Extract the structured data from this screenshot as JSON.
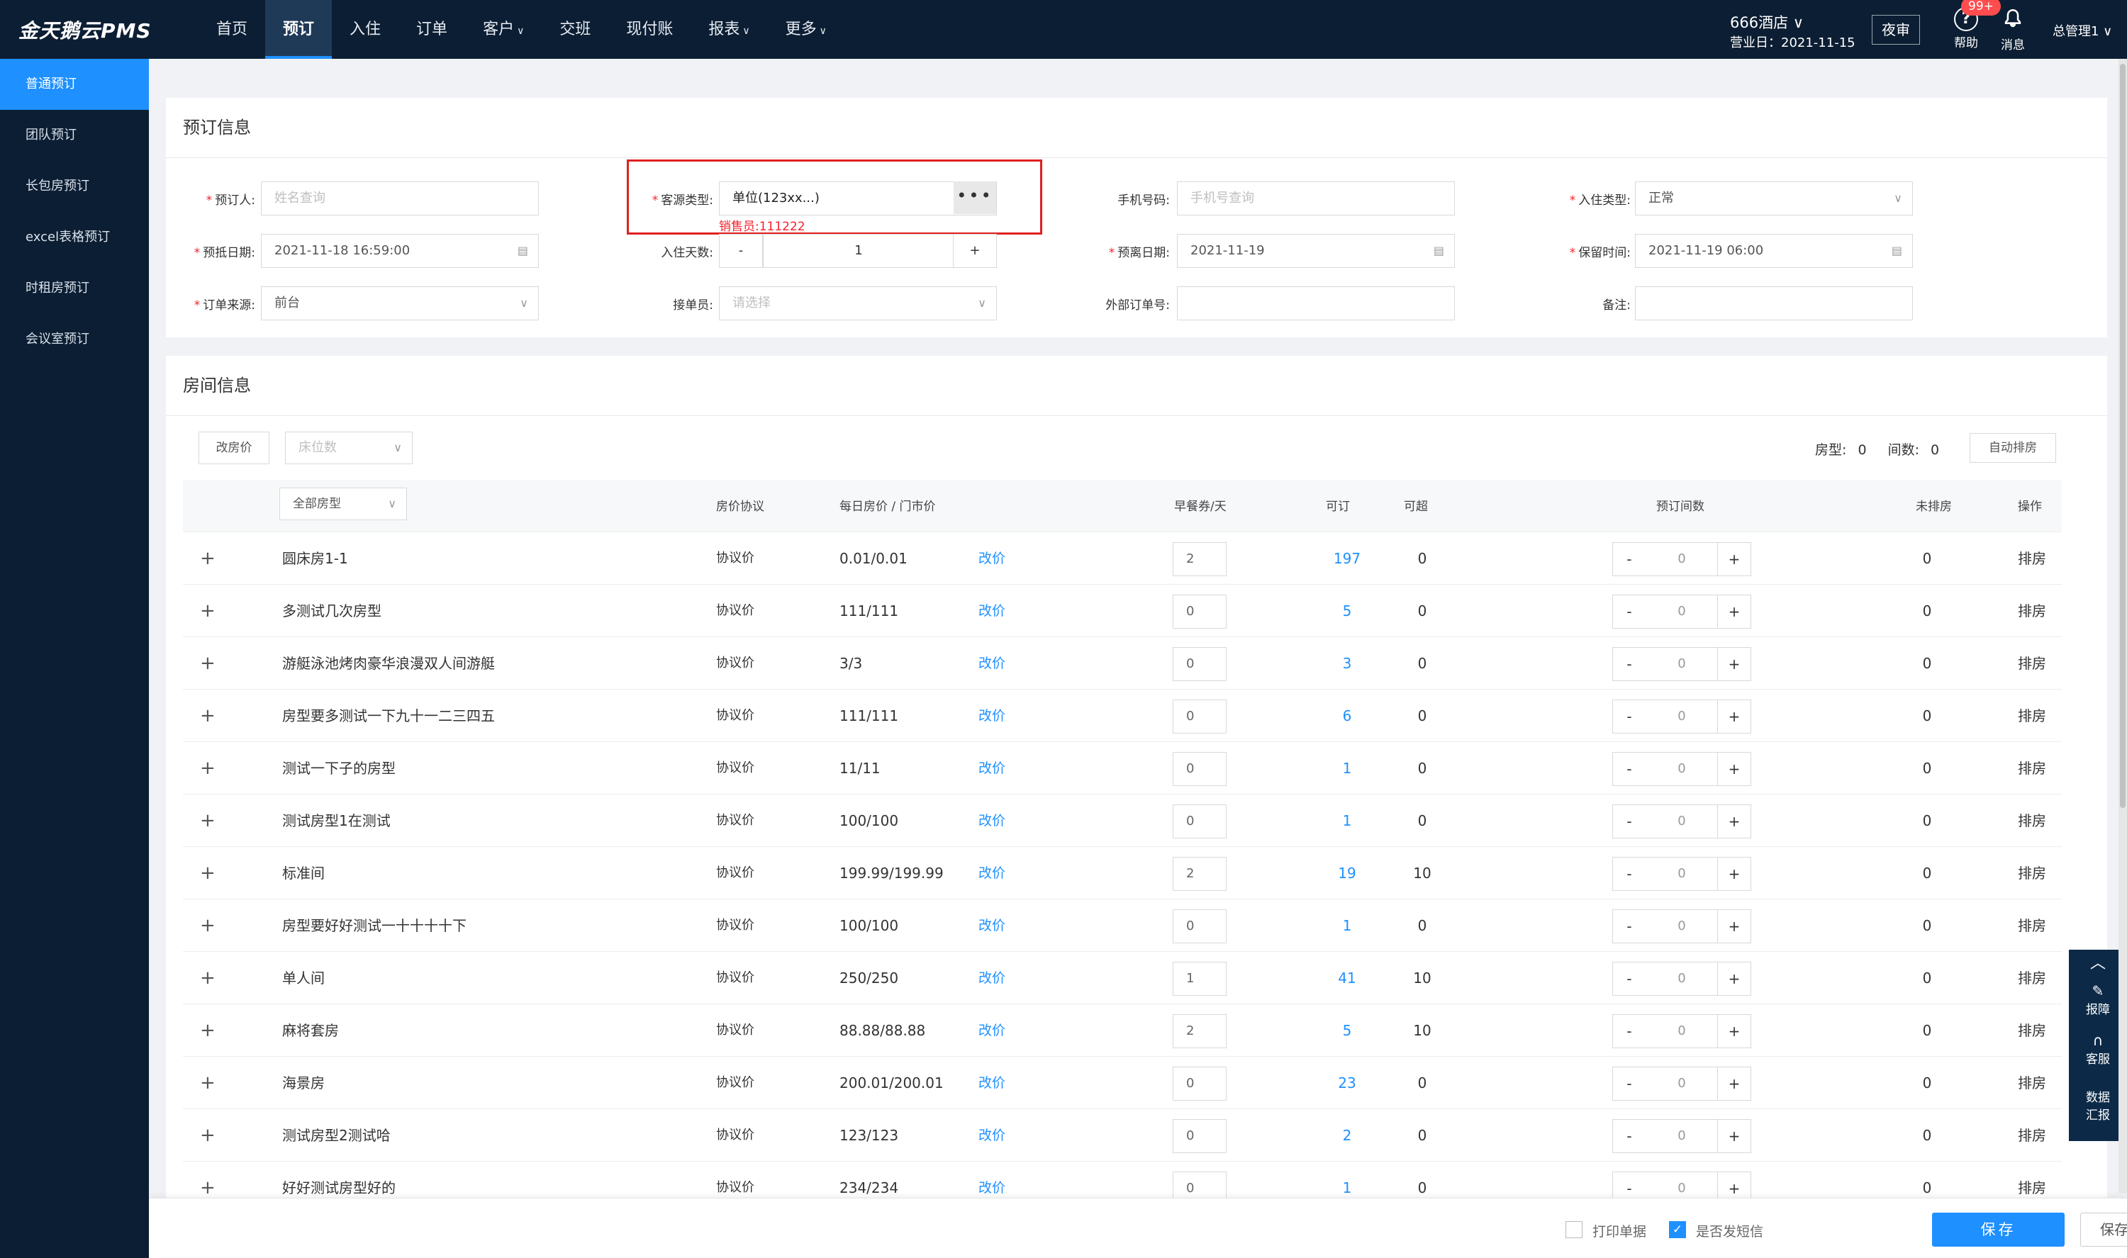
{
  "app": {
    "logo": "金天鹅云PMS"
  },
  "nav": [
    {
      "label": "首页",
      "caret": ""
    },
    {
      "label": "预订",
      "caret": "",
      "active": true
    },
    {
      "label": "入住",
      "caret": ""
    },
    {
      "label": "订单",
      "caret": ""
    },
    {
      "label": "客户",
      "caret": "∨"
    },
    {
      "label": "交班",
      "caret": ""
    },
    {
      "label": "现付账",
      "caret": ""
    },
    {
      "label": "报表",
      "caret": "∨"
    },
    {
      "label": "更多",
      "caret": "∨"
    }
  ],
  "header": {
    "hotel": "666酒店 ∨",
    "business_date": "营业日：2021-11-15",
    "audit": "夜审",
    "help": "帮助",
    "messages": "消息",
    "badge": "99+",
    "admin": "总管理1 ∨"
  },
  "sidebar": [
    {
      "label": "普通预订",
      "active": true
    },
    {
      "label": "团队预订"
    },
    {
      "label": "长包房预订"
    },
    {
      "label": "excel表格预订"
    },
    {
      "label": "时租房预订"
    },
    {
      "label": "会议室预订"
    }
  ],
  "booking": {
    "title": "预订信息",
    "booker_label": "预订人:",
    "booker_placeholder": "姓名查询",
    "source_type_label": "客源类型:",
    "source_type_value": "单位(123xx...)",
    "salesperson": "销售员:111222",
    "phone_label": "手机号码:",
    "phone_placeholder": "手机号查询",
    "checkin_type_label": "入住类型:",
    "checkin_type_value": "正常",
    "arrive_label": "预抵日期:",
    "arrive_value": "2021-11-18 16:59:00",
    "days_label": "入住天数:",
    "days_minus": "-",
    "days_value": "1",
    "days_plus": "+",
    "depart_label": "预离日期:",
    "depart_value": "2021-11-19",
    "hold_label": "保留时间:",
    "hold_value": "2021-11-19 06:00",
    "order_source_label": "订单来源:",
    "order_source_value": "前台",
    "taker_label": "接单员:",
    "taker_placeholder": "请选择",
    "external_label": "外部订单号:",
    "remark_label": "备注:"
  },
  "rooms": {
    "title": "房间信息",
    "change_price_btn": "改房价",
    "bed_placeholder": "床位数",
    "summary_type_label": "房型:",
    "summary_type_value": "0",
    "summary_count_label": "间数:",
    "summary_count_value": "0",
    "auto_assign_btn": "自动排房",
    "room_type_filter": "全部房型",
    "columns": {
      "agreement": "房价协议",
      "price": "每日房价 / 门市价",
      "breakfast": "早餐券/天",
      "available": "可订",
      "over": "可超",
      "book_count": "预订间数",
      "unassigned": "未排房",
      "action": "操作"
    },
    "rows": [
      {
        "name": "圆床房1-1",
        "agreement": "协议价",
        "price": "0.01/0.01",
        "edit": "改价",
        "breakfast": "2",
        "available": "197",
        "over": "0",
        "count": "0",
        "unassigned": "0",
        "action": "排房"
      },
      {
        "name": "多测试几次房型",
        "agreement": "协议价",
        "price": "111/111",
        "edit": "改价",
        "breakfast": "0",
        "available": "5",
        "over": "0",
        "count": "0",
        "unassigned": "0",
        "action": "排房"
      },
      {
        "name": "游艇泳池烤肉豪华浪漫双人间游艇",
        "agreement": "协议价",
        "price": "3/3",
        "edit": "改价",
        "breakfast": "0",
        "available": "3",
        "over": "0",
        "count": "0",
        "unassigned": "0",
        "action": "排房"
      },
      {
        "name": "房型要多测试一下九十一二三四五",
        "agreement": "协议价",
        "price": "111/111",
        "edit": "改价",
        "breakfast": "0",
        "available": "6",
        "over": "0",
        "count": "0",
        "unassigned": "0",
        "action": "排房"
      },
      {
        "name": "测试一下子的房型",
        "agreement": "协议价",
        "price": "11/11",
        "edit": "改价",
        "breakfast": "0",
        "available": "1",
        "over": "0",
        "count": "0",
        "unassigned": "0",
        "action": "排房"
      },
      {
        "name": "测试房型1在测试",
        "agreement": "协议价",
        "price": "100/100",
        "edit": "改价",
        "breakfast": "0",
        "available": "1",
        "over": "0",
        "count": "0",
        "unassigned": "0",
        "action": "排房"
      },
      {
        "name": "标准间",
        "agreement": "协议价",
        "price": "199.99/199.99",
        "edit": "改价",
        "breakfast": "2",
        "available": "19",
        "over": "10",
        "count": "0",
        "unassigned": "0",
        "action": "排房"
      },
      {
        "name": "房型要好好测试一十十十十下",
        "agreement": "协议价",
        "price": "100/100",
        "edit": "改价",
        "breakfast": "0",
        "available": "1",
        "over": "0",
        "count": "0",
        "unassigned": "0",
        "action": "排房"
      },
      {
        "name": "单人间",
        "agreement": "协议价",
        "price": "250/250",
        "edit": "改价",
        "breakfast": "1",
        "available": "41",
        "over": "10",
        "count": "0",
        "unassigned": "0",
        "action": "排房"
      },
      {
        "name": "麻将套房",
        "agreement": "协议价",
        "price": "88.88/88.88",
        "edit": "改价",
        "breakfast": "2",
        "available": "5",
        "over": "10",
        "count": "0",
        "unassigned": "0",
        "action": "排房"
      },
      {
        "name": "海景房",
        "agreement": "协议价",
        "price": "200.01/200.01",
        "edit": "改价",
        "breakfast": "0",
        "available": "23",
        "over": "0",
        "count": "0",
        "unassigned": "0",
        "action": "排房"
      },
      {
        "name": "测试房型2测试哈",
        "agreement": "协议价",
        "price": "123/123",
        "edit": "改价",
        "breakfast": "0",
        "available": "2",
        "over": "0",
        "count": "0",
        "unassigned": "0",
        "action": "排房"
      },
      {
        "name": "好好测试房型好的",
        "agreement": "协议价",
        "price": "234/234",
        "edit": "改价",
        "breakfast": "0",
        "available": "1",
        "over": "0",
        "count": "0",
        "unassigned": "0",
        "action": "排房"
      }
    ]
  },
  "float_panel": {
    "report": "报障",
    "service": "客服",
    "data1": "数据",
    "data2": "汇报"
  },
  "footer": {
    "print_label": "打印单据",
    "print_checked": false,
    "sms_label": "是否发短信",
    "sms_checked": true,
    "save": "保存",
    "save_continue": "保存后继续办预订"
  },
  "colors": {
    "nav_bg": "#0c1e33",
    "accent": "#1e90ff",
    "required": "#f5222d"
  }
}
